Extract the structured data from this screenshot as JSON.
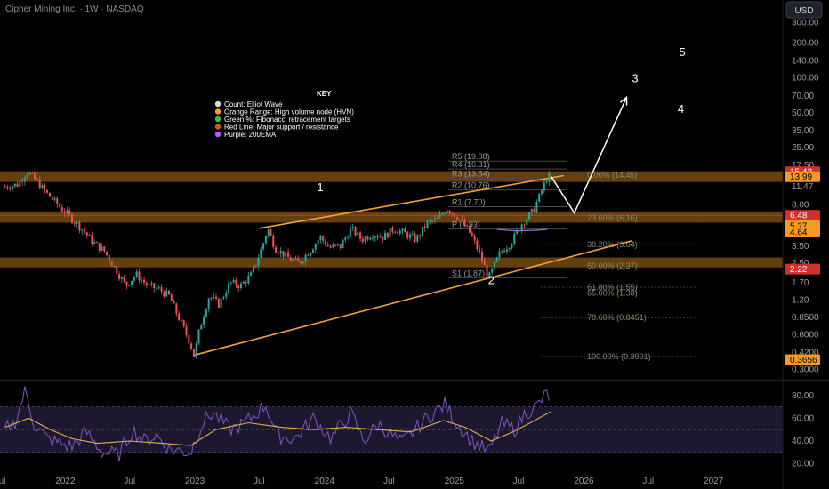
{
  "header": {
    "title": "Cipher Mining Inc. · 1W · NASDAQ",
    "currency_button": "USD"
  },
  "chart_data": {
    "type": "candlestick",
    "title": "Cipher Mining Inc. · 1W · NASDAQ",
    "y_scale": "log",
    "ylim": [
      0.25,
      320
    ],
    "x_range": [
      "2021-07-01",
      "2027-07-15"
    ],
    "price_ticks": [
      "300.00",
      "200.00",
      "140.00",
      "100.00",
      "70.00",
      "50.00",
      "35.00",
      "25.00",
      "17.50",
      "11.47",
      "8.00",
      "5.50",
      "3.50",
      "2.50",
      "1.70",
      "1.20",
      "0.8500",
      "0.6000",
      "0.4200",
      "0.3000"
    ],
    "price_tick_values": [
      300,
      200,
      140,
      100,
      70,
      50,
      35,
      25,
      17.5,
      11.47,
      8,
      5.5,
      3.5,
      2.5,
      1.7,
      1.2,
      0.85,
      0.6,
      0.42,
      0.3
    ],
    "x_ticks": [
      {
        "label": "Jul",
        "date": "2021-07-01"
      },
      {
        "label": "2022",
        "date": "2022-01-01"
      },
      {
        "label": "Jul",
        "date": "2022-07-01"
      },
      {
        "label": "2023",
        "date": "2023-01-01"
      },
      {
        "label": "Jul",
        "date": "2023-07-01"
      },
      {
        "label": "2024",
        "date": "2024-01-01"
      },
      {
        "label": "Jul",
        "date": "2024-07-01"
      },
      {
        "label": "2025",
        "date": "2025-01-01"
      },
      {
        "label": "Jul",
        "date": "2025-07-01"
      },
      {
        "label": "2026",
        "date": "2026-01-01"
      },
      {
        "label": "Jul",
        "date": "2026-07-01"
      },
      {
        "label": "2027",
        "date": "2027-01-01"
      }
    ],
    "price_path": [
      {
        "date": "2021-07-15",
        "value": 11.5
      },
      {
        "date": "2021-08-20",
        "value": 12.0
      },
      {
        "date": "2021-09-15",
        "value": 15.5
      },
      {
        "date": "2021-10-10",
        "value": 13.0
      },
      {
        "date": "2021-11-10",
        "value": 10.0
      },
      {
        "date": "2021-12-10",
        "value": 8.0
      },
      {
        "date": "2022-01-10",
        "value": 6.5
      },
      {
        "date": "2022-02-15",
        "value": 5.0
      },
      {
        "date": "2022-03-20",
        "value": 3.8
      },
      {
        "date": "2022-04-20",
        "value": 3.2
      },
      {
        "date": "2022-05-20",
        "value": 2.3
      },
      {
        "date": "2022-06-20",
        "value": 1.6
      },
      {
        "date": "2022-07-20",
        "value": 2.0
      },
      {
        "date": "2022-08-20",
        "value": 1.6
      },
      {
        "date": "2022-09-20",
        "value": 1.5
      },
      {
        "date": "2022-10-20",
        "value": 1.3
      },
      {
        "date": "2022-11-20",
        "value": 0.8
      },
      {
        "date": "2022-12-20",
        "value": 0.5
      },
      {
        "date": "2022-12-30",
        "value": 0.39
      },
      {
        "date": "2023-01-15",
        "value": 0.7
      },
      {
        "date": "2023-02-10",
        "value": 1.3
      },
      {
        "date": "2023-03-10",
        "value": 1.1
      },
      {
        "date": "2023-04-10",
        "value": 1.7
      },
      {
        "date": "2023-05-10",
        "value": 1.6
      },
      {
        "date": "2023-06-10",
        "value": 2.0
      },
      {
        "date": "2023-07-10",
        "value": 3.5
      },
      {
        "date": "2023-07-25",
        "value": 5.0
      },
      {
        "date": "2023-08-15",
        "value": 3.4
      },
      {
        "date": "2023-09-20",
        "value": 2.8
      },
      {
        "date": "2023-10-20",
        "value": 2.5
      },
      {
        "date": "2023-11-20",
        "value": 3.2
      },
      {
        "date": "2023-12-20",
        "value": 4.2
      },
      {
        "date": "2024-01-15",
        "value": 3.4
      },
      {
        "date": "2024-02-15",
        "value": 3.5
      },
      {
        "date": "2024-03-15",
        "value": 5.0
      },
      {
        "date": "2024-04-15",
        "value": 4.0
      },
      {
        "date": "2024-05-15",
        "value": 4.5
      },
      {
        "date": "2024-06-15",
        "value": 4.2
      },
      {
        "date": "2024-07-15",
        "value": 5.0
      },
      {
        "date": "2024-08-15",
        "value": 4.5
      },
      {
        "date": "2024-09-15",
        "value": 4.0
      },
      {
        "date": "2024-10-15",
        "value": 5.5
      },
      {
        "date": "2024-11-15",
        "value": 6.0
      },
      {
        "date": "2024-12-10",
        "value": 7.5
      },
      {
        "date": "2025-01-10",
        "value": 6.3
      },
      {
        "date": "2025-02-10",
        "value": 4.8
      },
      {
        "date": "2025-03-10",
        "value": 3.2
      },
      {
        "date": "2025-04-08",
        "value": 1.87
      },
      {
        "date": "2025-05-10",
        "value": 3.1
      },
      {
        "date": "2025-06-10",
        "value": 3.8
      },
      {
        "date": "2025-07-10",
        "value": 5.5
      },
      {
        "date": "2025-08-10",
        "value": 7.0
      },
      {
        "date": "2025-09-01",
        "value": 10.0
      },
      {
        "date": "2025-09-20",
        "value": 14.0
      },
      {
        "date": "2025-10-01",
        "value": 13.99
      }
    ],
    "ema200_path": [
      {
        "date": "2025-05-01",
        "value": 4.9
      },
      {
        "date": "2025-06-01",
        "value": 4.8
      },
      {
        "date": "2025-07-01",
        "value": 4.75
      },
      {
        "date": "2025-08-15",
        "value": 4.8
      },
      {
        "date": "2025-09-20",
        "value": 4.9
      }
    ],
    "projection_path": [
      {
        "date": "2025-10-01",
        "value": 14.0
      },
      {
        "date": "2025-12-05",
        "value": 6.8
      },
      {
        "date": "2026-05-01",
        "value": 68
      }
    ],
    "channel_lines": [
      {
        "name": "upper",
        "start": {
          "date": "2023-07-01",
          "value": 5.0
        },
        "end": {
          "date": "2025-11-05",
          "value": 14.3
        }
      },
      {
        "name": "lower",
        "start": {
          "date": "2022-12-30",
          "value": 0.4
        },
        "end": {
          "date": "2026-05-15",
          "value": 3.9
        }
      }
    ],
    "hvn_bands": [
      {
        "low": 12.6,
        "high": 15.43
      },
      {
        "low": 5.6,
        "high": 7.0
      },
      {
        "low": 2.3,
        "high": 2.8
      }
    ],
    "resistance_lines": [
      15.43,
      6.48,
      2.22
    ],
    "pivots": [
      {
        "label": "R5 (19.08)",
        "value": 19.08
      },
      {
        "label": "R4 (16.31)",
        "value": 16.31
      },
      {
        "label": "R3 (13.54)",
        "value": 13.54
      },
      {
        "label": "R2 (10.76)",
        "value": 10.76
      },
      {
        "label": "R1 (7.70)",
        "value": 7.7
      },
      {
        "label": "P (4.93)",
        "value": 4.93
      },
      {
        "label": "S1 (1.87)",
        "value": 1.87
      }
    ],
    "fib_levels": [
      {
        "label": "0.00% (14.45)",
        "value": 14.45
      },
      {
        "label": "23.60% (6.16)",
        "value": 6.16
      },
      {
        "label": "38.20% (3.64)",
        "value": 3.64
      },
      {
        "label": "50.00% (2.37)",
        "value": 2.37
      },
      {
        "label": "61.80% (1.55)",
        "value": 1.55
      },
      {
        "label": "65.00% (1.38)",
        "value": 1.38
      },
      {
        "label": "78.60% (0.8451)",
        "value": 0.8451
      },
      {
        "label": "100.00% (0.3901)",
        "value": 0.3901
      }
    ],
    "wave_labels": [
      {
        "label": "1",
        "date": "2023-12-20",
        "value": 10.5
      },
      {
        "label": "2",
        "date": "2025-04-15",
        "value": 1.65
      },
      {
        "label": "3",
        "date": "2026-05-25",
        "value": 92
      },
      {
        "label": "4",
        "date": "2026-10-01",
        "value": 50
      },
      {
        "label": "5",
        "date": "2026-10-05",
        "value": 155
      }
    ],
    "price_badges": [
      {
        "label": "15.43",
        "value": 15.43,
        "color": "#d32f2f"
      },
      {
        "label": "13.99",
        "value": 13.99,
        "color": "#f59a23"
      },
      {
        "label": "6.48",
        "value": 6.48,
        "color": "#d32f2f"
      },
      {
        "label": "5.27",
        "value": 5.27,
        "color": "#f59a23"
      },
      {
        "label": "4.64",
        "value": 4.64,
        "color": "#f59a23"
      },
      {
        "label": "2.22",
        "value": 2.22,
        "color": "#d32f2f"
      },
      {
        "label": "0.3656",
        "value": 0.3656,
        "color": "#f59a23"
      }
    ],
    "rsi": {
      "ylim": [
        15,
        90
      ],
      "ticks": [
        80,
        60,
        40,
        20
      ],
      "tick_labels": [
        "80.00",
        "60.00",
        "40.00",
        "20.00"
      ],
      "band": [
        30,
        70
      ],
      "rsi_path": [
        {
          "date": "2021-07-15",
          "value": 50
        },
        {
          "date": "2021-08-15",
          "value": 58
        },
        {
          "date": "2021-09-10",
          "value": 85
        },
        {
          "date": "2021-10-05",
          "value": 55
        },
        {
          "date": "2021-11-10",
          "value": 42
        },
        {
          "date": "2021-12-15",
          "value": 38
        },
        {
          "date": "2022-01-20",
          "value": 35
        },
        {
          "date": "2022-03-01",
          "value": 48
        },
        {
          "date": "2022-04-15",
          "value": 30
        },
        {
          "date": "2022-06-01",
          "value": 28
        },
        {
          "date": "2022-07-10",
          "value": 50
        },
        {
          "date": "2022-08-10",
          "value": 40
        },
        {
          "date": "2022-09-15",
          "value": 45
        },
        {
          "date": "2022-10-20",
          "value": 33
        },
        {
          "date": "2022-12-20",
          "value": 30
        },
        {
          "date": "2023-01-20",
          "value": 55
        },
        {
          "date": "2023-02-20",
          "value": 65
        },
        {
          "date": "2023-04-10",
          "value": 50
        },
        {
          "date": "2023-05-20",
          "value": 55
        },
        {
          "date": "2023-07-20",
          "value": 72
        },
        {
          "date": "2023-08-20",
          "value": 45
        },
        {
          "date": "2023-10-10",
          "value": 42
        },
        {
          "date": "2023-12-01",
          "value": 60
        },
        {
          "date": "2024-01-20",
          "value": 42
        },
        {
          "date": "2024-03-15",
          "value": 65
        },
        {
          "date": "2024-04-20",
          "value": 40
        },
        {
          "date": "2024-06-01",
          "value": 55
        },
        {
          "date": "2024-08-05",
          "value": 38
        },
        {
          "date": "2024-10-15",
          "value": 60
        },
        {
          "date": "2024-12-05",
          "value": 72
        },
        {
          "date": "2025-01-10",
          "value": 55
        },
        {
          "date": "2025-02-20",
          "value": 40
        },
        {
          "date": "2025-04-08",
          "value": 30
        },
        {
          "date": "2025-05-15",
          "value": 55
        },
        {
          "date": "2025-06-20",
          "value": 50
        },
        {
          "date": "2025-07-20",
          "value": 65
        },
        {
          "date": "2025-08-20",
          "value": 70
        },
        {
          "date": "2025-09-20",
          "value": 82
        },
        {
          "date": "2025-10-01",
          "value": 75
        }
      ],
      "ma_path": [
        {
          "date": "2021-07-15",
          "value": 52
        },
        {
          "date": "2021-09-20",
          "value": 60
        },
        {
          "date": "2021-11-20",
          "value": 50
        },
        {
          "date": "2022-01-20",
          "value": 42
        },
        {
          "date": "2022-04-01",
          "value": 38
        },
        {
          "date": "2022-07-01",
          "value": 40
        },
        {
          "date": "2022-10-01",
          "value": 38
        },
        {
          "date": "2022-12-20",
          "value": 36
        },
        {
          "date": "2023-03-01",
          "value": 50
        },
        {
          "date": "2023-06-01",
          "value": 56
        },
        {
          "date": "2023-09-01",
          "value": 52
        },
        {
          "date": "2023-12-01",
          "value": 50
        },
        {
          "date": "2024-03-01",
          "value": 52
        },
        {
          "date": "2024-06-01",
          "value": 50
        },
        {
          "date": "2024-09-01",
          "value": 48
        },
        {
          "date": "2024-12-01",
          "value": 58
        },
        {
          "date": "2025-02-01",
          "value": 52
        },
        {
          "date": "2025-04-15",
          "value": 40
        },
        {
          "date": "2025-06-15",
          "value": 48
        },
        {
          "date": "2025-08-15",
          "value": 58
        },
        {
          "date": "2025-10-01",
          "value": 66
        }
      ]
    },
    "legend": {
      "title": "KEY",
      "placement": "top-center",
      "entries": [
        {
          "label": "Count: Elliot Wave",
          "color": "#d9d9d9"
        },
        {
          "label": "Orange Range: High volume node (HVN)",
          "color": "#f59a23"
        },
        {
          "label": "Green %: Fibonacci retracement targets",
          "color": "#3fbf3f"
        },
        {
          "label": "Red Line: Major support / resistance",
          "color": "#e0531f"
        },
        {
          "label": "Purple: 200EMA",
          "color": "#b05cff"
        }
      ]
    },
    "colors": {
      "up": "#26a69a",
      "down": "#ef5350",
      "hvn": "#b8741a",
      "resistance": "#c0392b",
      "channel": "#f5a13a",
      "rsi": "#7e57c2",
      "rsi_ma": "#e0b24a",
      "ema": "#9b6fd0",
      "projection": "#ffffff",
      "pivot_line": "#4a4a4a"
    }
  }
}
